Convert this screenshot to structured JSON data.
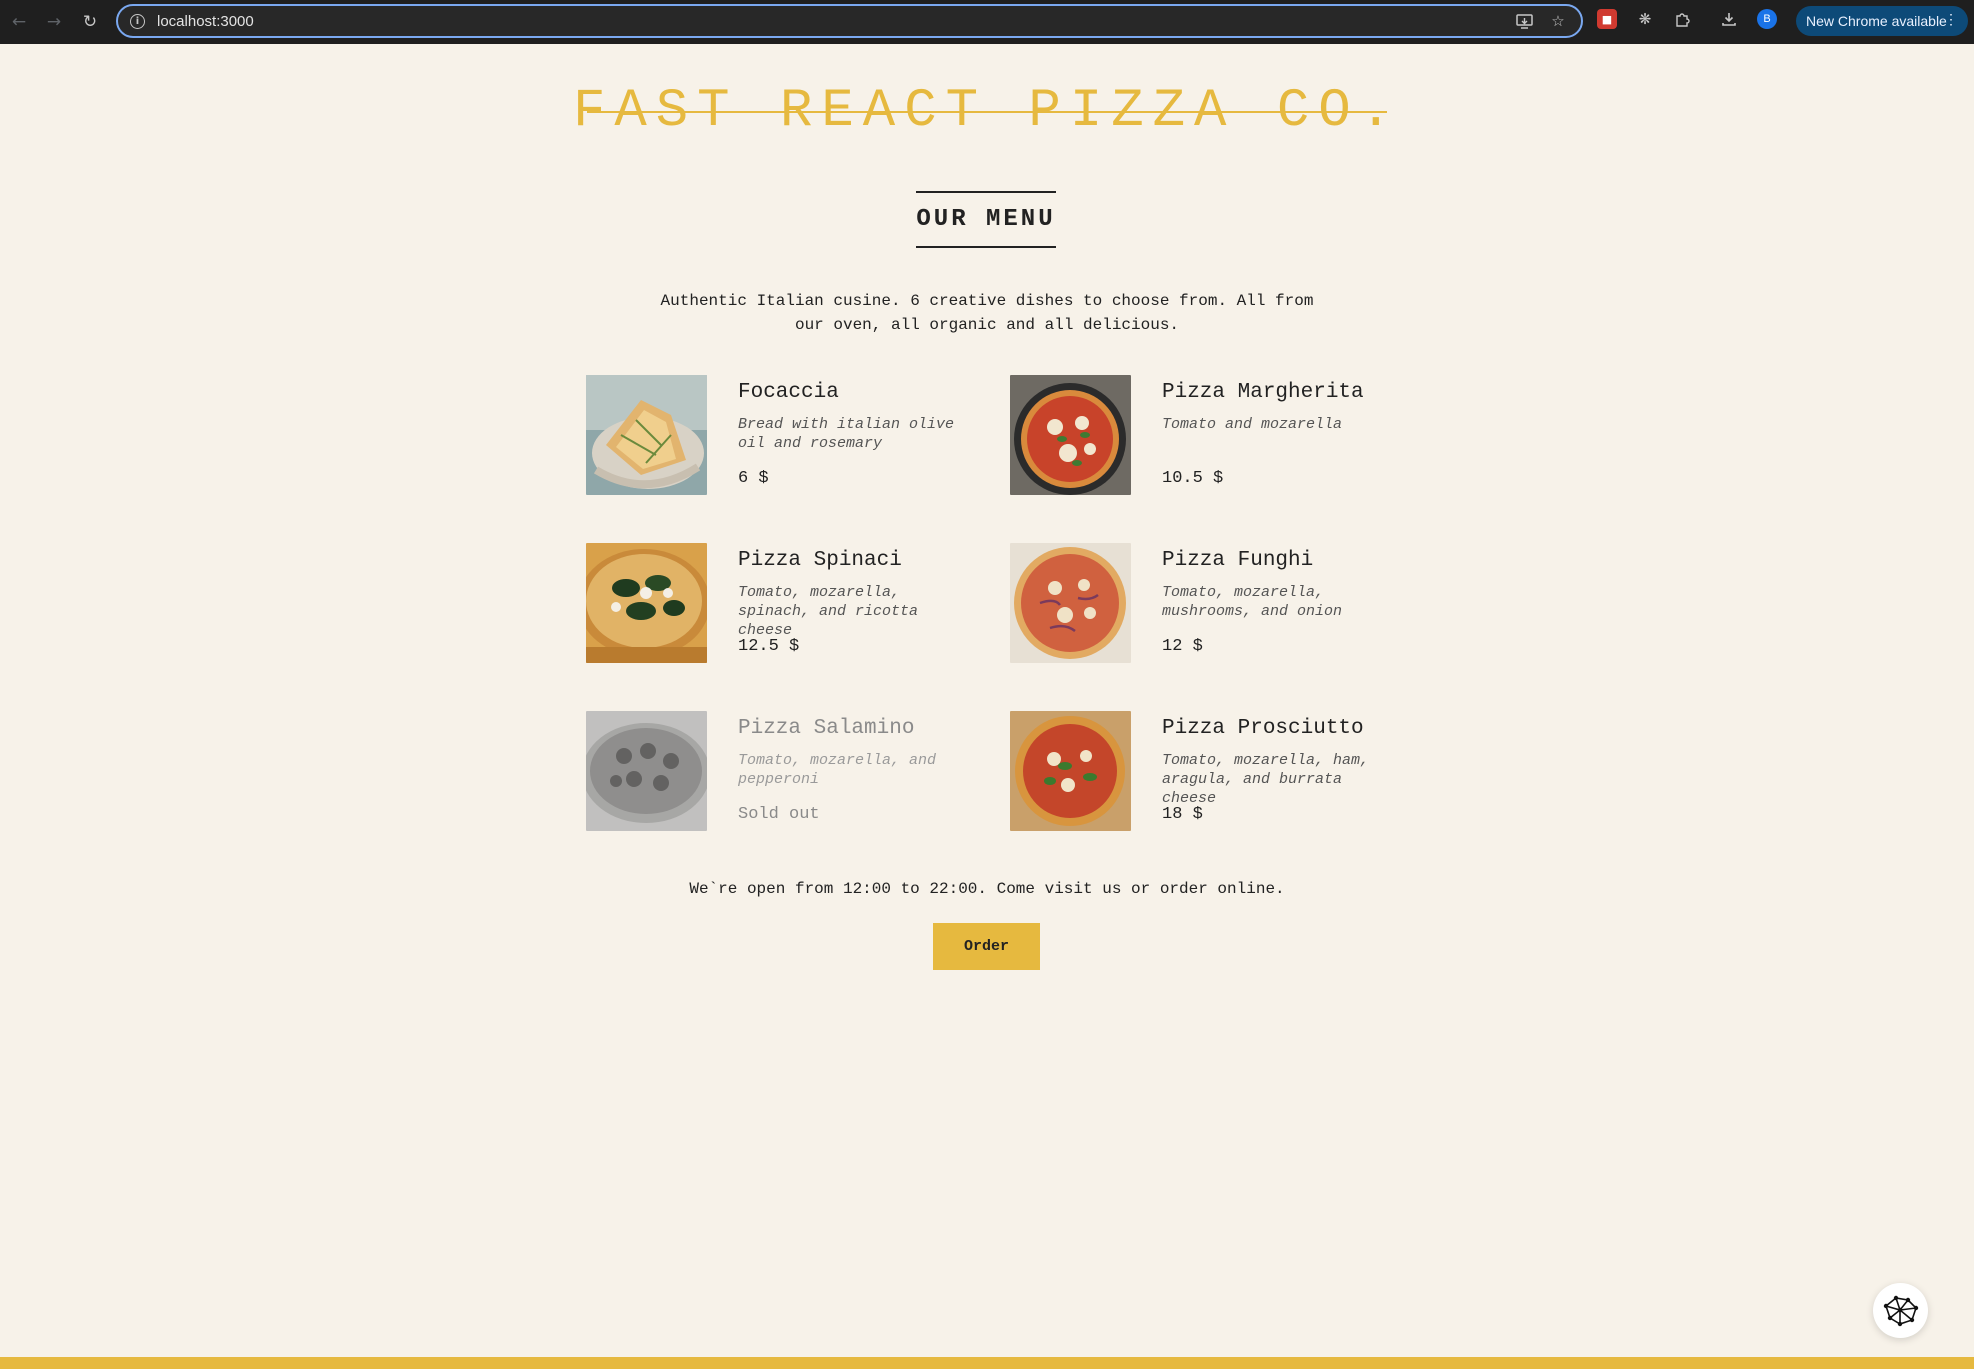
{
  "browser": {
    "url": "localhost:3000",
    "avatar_letter": "B",
    "update_label": "New Chrome available"
  },
  "page": {
    "logo": "FAST REACT PIZZA CO.",
    "menu_title": "OUR MENU",
    "intro": "Authentic Italian cusine. 6 creative dishes to choose from. All from our oven, all organic and all delicious.",
    "items": [
      {
        "name": "Focaccia",
        "ingredients": "Bread with italian olive oil and rosemary",
        "price": "6 $",
        "sold_out": false,
        "image": "focaccia-photo"
      },
      {
        "name": "Pizza Margherita",
        "ingredients": "Tomato and mozarella",
        "price": "10.5 $",
        "sold_out": false,
        "image": "margherita-photo"
      },
      {
        "name": "Pizza Spinaci",
        "ingredients": "Tomato, mozarella, spinach, and ricotta cheese",
        "price": "12.5 $",
        "sold_out": false,
        "image": "spinaci-photo"
      },
      {
        "name": "Pizza Funghi",
        "ingredients": "Tomato, mozarella, mushrooms, and onion",
        "price": "12 $",
        "sold_out": false,
        "image": "funghi-photo"
      },
      {
        "name": "Pizza Salamino",
        "ingredients": "Tomato, mozarella, and pepperoni",
        "price": "Sold out",
        "sold_out": true,
        "image": "salamino-photo"
      },
      {
        "name": "Pizza Prosciutto",
        "ingredients": "Tomato, mozarella, ham, aragula, and burrata cheese",
        "price": "18 $",
        "sold_out": false,
        "image": "prosciutto-photo"
      }
    ],
    "hours": "We`re open from 12:00 to 22:00. Come visit us or order online.",
    "order_label": "Order"
  },
  "colors": {
    "background": "#f7f2e9",
    "accent": "#e6b93f",
    "text": "#222222"
  }
}
